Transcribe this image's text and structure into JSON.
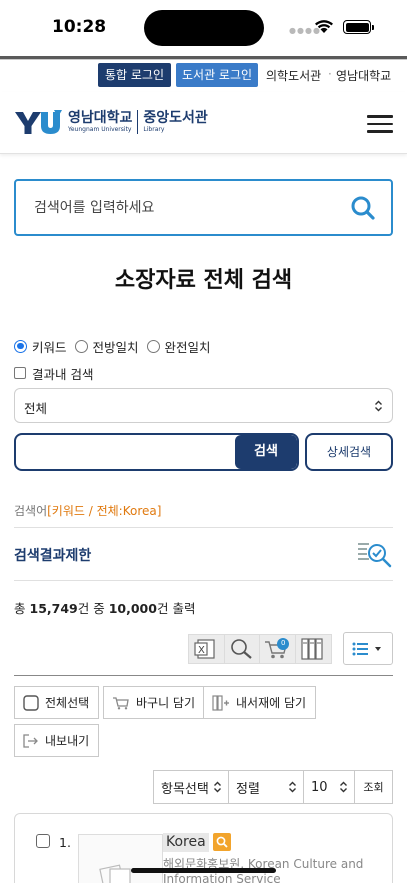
{
  "status": {
    "time": "10:28"
  },
  "util": {
    "login_integrated": "통합 로그인",
    "login_library": "도서관 로그인",
    "medical_library": "의학도서관",
    "university": "영남대학교"
  },
  "header": {
    "logo_univ_kr": "영남대학교",
    "logo_univ_en": "Yeungnam University",
    "logo_lib_kr": "중앙도서관",
    "logo_lib_en": "Library"
  },
  "main_search": {
    "placeholder": "검색어를 입력하세요"
  },
  "page_title": "소장자료 전체 검색",
  "search_options": {
    "radios": [
      {
        "label": "키워드",
        "checked": true
      },
      {
        "label": "전방일치",
        "checked": false
      },
      {
        "label": "완전일치",
        "checked": false
      }
    ],
    "within_results_label": "결과내 검색",
    "scope_selected": "전체",
    "search_button": "검색",
    "advanced_button": "상세검색"
  },
  "query": {
    "label": "검색어",
    "term": "[키워드 / 전체:Korea]"
  },
  "filter": {
    "title": "검색결과제한"
  },
  "result_count": {
    "prefix": "총",
    "total": "15,749",
    "mid": "건 중",
    "shown": "10,000",
    "suffix": "건 출력"
  },
  "toolbar": {
    "cart_badge": "0"
  },
  "actions": {
    "select_all": "전체선택",
    "add_cart": "바구니 담기",
    "add_bookshelf": "내서재에 담기",
    "export": "내보내기"
  },
  "sort": {
    "item_select": "항목선택",
    "order": "정렬",
    "page_size": "10",
    "query_button": "조회"
  },
  "results": [
    {
      "number": "1.",
      "title": "Korea",
      "author_line1": "해외문화홍보원, Korean Culture and",
      "author_line2": "Information Service"
    }
  ],
  "colors": {
    "primary_navy": "#1d3c6e",
    "accent_blue": "#2b8ccd",
    "login_blue": "#3a7bc8",
    "query_orange": "#e07a10",
    "search_icon_orange": "#f2a42c"
  }
}
